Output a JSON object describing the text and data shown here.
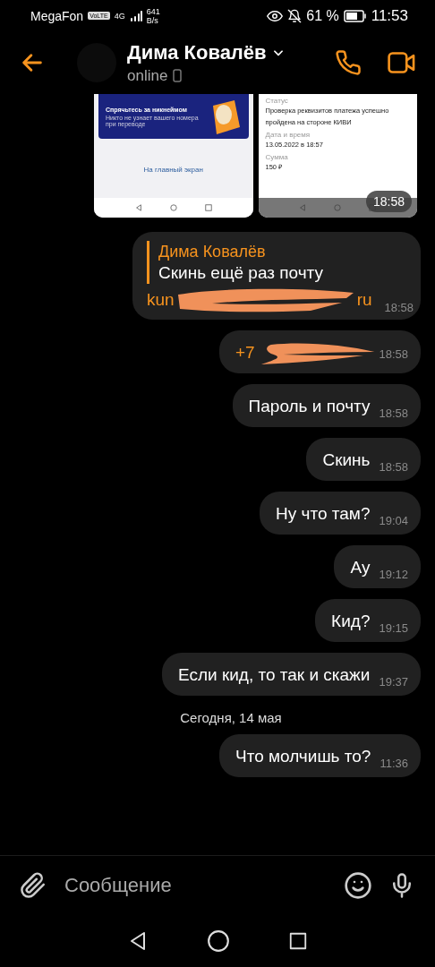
{
  "status_bar": {
    "carrier": "MegaFon",
    "volte": "VoLTE",
    "network": "4G",
    "speed": "641",
    "speed_unit": "B/s",
    "battery": "61 %",
    "time": "11:53"
  },
  "header": {
    "name": "Дима Ковалёв",
    "status": "online"
  },
  "shared_images": {
    "time": "18:58",
    "left": {
      "banner_title": "Спрячьтесь за никнеймом",
      "banner_text": "Никто не узнает вашего номера при переводе",
      "link": "На главный экран"
    },
    "right": {
      "fields": [
        {
          "label": "Статус",
          "value": "Проверка реквизитов платежа успешно пройдена на стороне КИВИ"
        },
        {
          "label": "Дата и время",
          "value": "13.05.2022 в 18:57"
        },
        {
          "label": "Сумма",
          "value": "150 ₽"
        }
      ]
    }
  },
  "messages": [
    {
      "kind": "quote",
      "author": "Дима Ковалёв",
      "quote": "Скинь ещё раз почту",
      "link_start": "kun",
      "link_end": "ru",
      "time": "18:58"
    },
    {
      "kind": "redacted",
      "text": "+7",
      "time": "18:58"
    },
    {
      "kind": "text",
      "text": "Пароль и почту",
      "time": "18:58"
    },
    {
      "kind": "text",
      "text": "Скинь",
      "time": "18:58"
    },
    {
      "kind": "text",
      "text": "Ну что там?",
      "time": "19:04"
    },
    {
      "kind": "text",
      "text": "Ау",
      "time": "19:12"
    },
    {
      "kind": "text",
      "text": "Кид?",
      "time": "19:15"
    },
    {
      "kind": "text",
      "text": "Если кид, то так и скажи",
      "time": "19:37"
    },
    {
      "kind": "date",
      "text": "Сегодня, 14 мая"
    },
    {
      "kind": "text",
      "text": "Что молчишь то?",
      "time": "11:36"
    }
  ],
  "composer": {
    "placeholder": "Сообщение"
  }
}
